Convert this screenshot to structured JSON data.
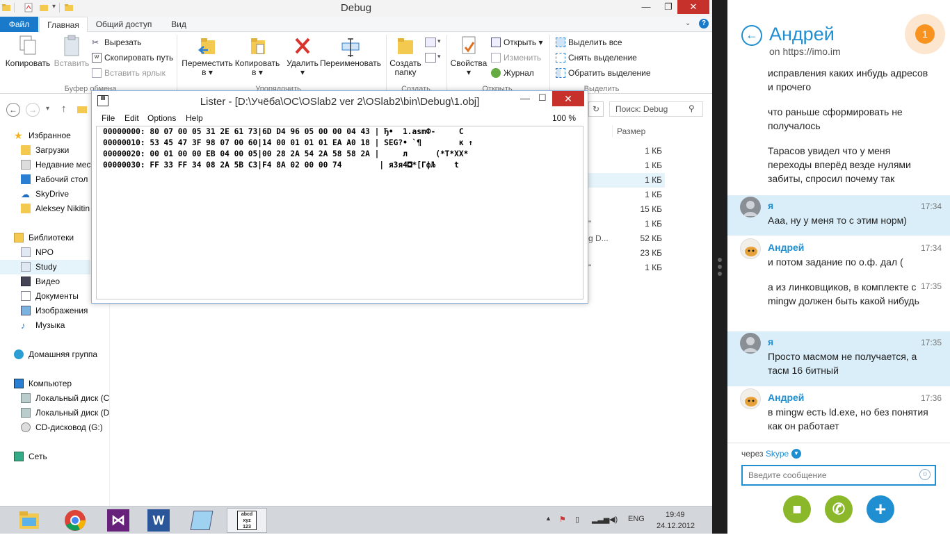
{
  "explorer": {
    "title": "Debug",
    "tabs": {
      "file": "Файл",
      "home": "Главная",
      "share": "Общий доступ",
      "view": "Вид"
    },
    "ribbon": {
      "copy": "Копировать",
      "paste": "Вставить",
      "cut": "Вырезать",
      "copy_path": "Скопировать путь",
      "paste_shortcut": "Вставить ярлык",
      "clipboard_group": "Буфер обмена",
      "move_to": "Переместить",
      "move_to_2": "в",
      "copy_to": "Копировать",
      "copy_to_2": "в",
      "delete": "Удалить",
      "rename": "Переименовать",
      "organize_group": "Упорядочить",
      "new_folder": "Создать",
      "new_folder_2": "папку",
      "new_group": "Создать",
      "properties": "Свойства",
      "open": "Открыть",
      "edit": "Изменить",
      "history": "Журнал",
      "open_group": "Открыть",
      "select_all": "Выделить все",
      "select_none": "Снять выделение",
      "invert_selection": "Обратить выделение",
      "select_group": "Выделить"
    },
    "search_placeholder": "Поиск: Debug",
    "column_size": "Размер",
    "nav": {
      "favorites": "Избранное",
      "downloads": "Загрузки",
      "recent": "Недавние мест",
      "desktop": "Рабочий стол",
      "skydrive": "SkyDrive",
      "user": "Aleksey Nikitin",
      "libraries": "Библиотеки",
      "npo": "NPO",
      "study": "Study",
      "video": "Видео",
      "documents": "Документы",
      "images": "Изображения",
      "music": "Музыка",
      "homegroup": "Домашняя группа",
      "computer": "Компьютер",
      "disk_c": "Локальный диск (C",
      "disk_d": "Локальный диск (D",
      "cd": "CD-дисковод (G:)",
      "network": "Сеть"
    },
    "sizes": [
      "1 КБ",
      "1 КБ",
      "1 КБ",
      "1 КБ",
      "15 КБ",
      "1 КБ",
      "52 КБ",
      "23 КБ",
      "1 КБ"
    ],
    "fragments": {
      "quote1": "\"",
      "g_d": "g D...",
      "quote2": "\""
    }
  },
  "lister": {
    "title": "Lister - [D:\\Учёба\\ОС\\OSlab2 ver 2\\OSlab2\\bin\\Debug\\1.obj]",
    "menu": {
      "file": "File",
      "edit": "Edit",
      "options": "Options",
      "help": "Help"
    },
    "zoom": "100 %",
    "lines": [
      "00000000: 80 07 00 05 31 2E 61 73|6D D4 96 05 00 00 04 43 | Ђ•  1.asmФ-     C",
      "00000010: 53 45 47 3F 98 07 00 60|14 00 01 01 01 EA A0 18 | SEG?• `¶        к ↑",
      "00000020: 00 01 00 00 EB 04 00 05|00 28 2A 54 2A 58 58 2A |     л      (*T*XX*",
      "00000030: FF 33 FF 34 08 2A 5B C3|F4 8A 02 00 00 74        | я3я4◘*[ГфЉ    t"
    ]
  },
  "taskbar": {
    "lang": "ENG",
    "time": "19:49",
    "date": "24.12.2012"
  },
  "chat": {
    "contact": "Андрей",
    "subtitle": "on https://imo.im",
    "badge": "1",
    "messages": [
      {
        "text": "исправления каких инбудь адресов и прочего"
      },
      {
        "text": "что раньше сформировать не получалось"
      },
      {
        "text": "Тарасов увидел что у меня переходы вперёд везде нулями забиты, спросил почему так"
      },
      {
        "sender": "я",
        "time": "17:34",
        "text": "Ааа, ну у меня то с этим норм)"
      },
      {
        "sender": "Андрей",
        "time": "17:34",
        "text": "и потом задание по о.ф. дал ("
      },
      {
        "time": "17:35",
        "text": "а из линковщиков, в комплекте с mingw должен быть какой нибудь"
      },
      {
        "sender": "я",
        "time": "17:35",
        "text": "Просто масмом не получается, а тасм 16 битный"
      },
      {
        "sender": "Андрей",
        "time": "17:36",
        "text": "в mingw есть ld.exe, но без понятия как он работает"
      }
    ],
    "via_prefix": "через",
    "via_service": "Skype",
    "input_placeholder": "Введите сообщение",
    "colors": {
      "accent": "#1f8fd1",
      "video": "#8bb82a",
      "call": "#8bb82a",
      "add": "#1f8fd1",
      "badge": "#f7931e"
    }
  }
}
